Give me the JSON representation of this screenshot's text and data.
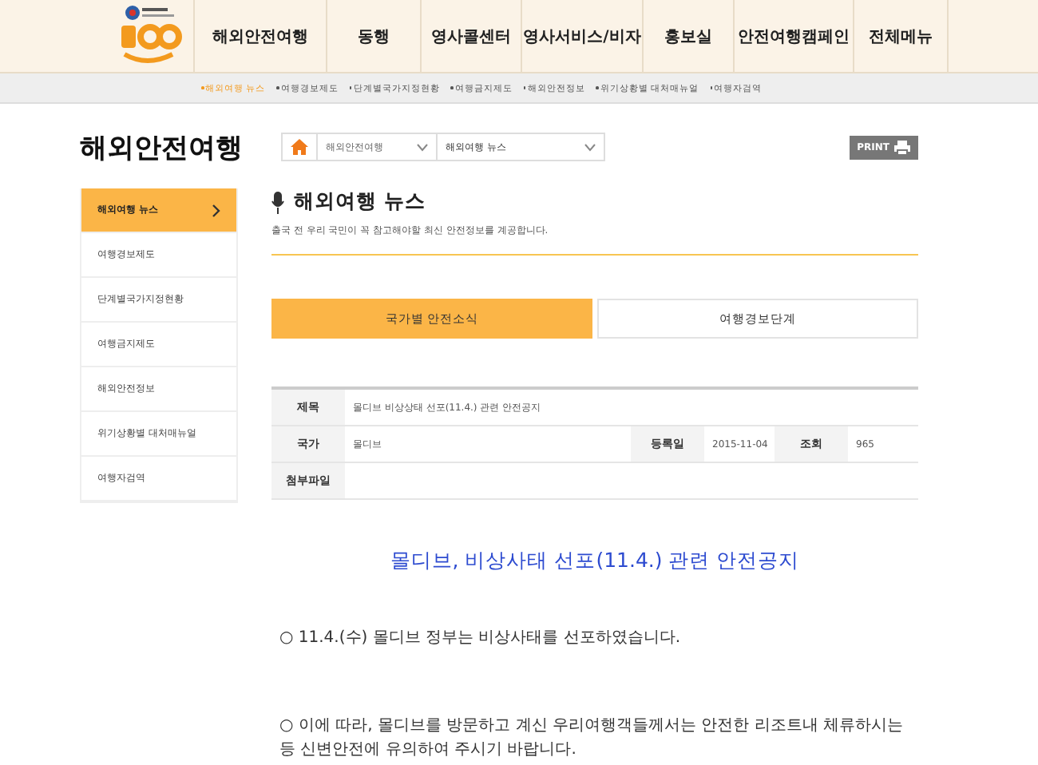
{
  "nav": [
    {
      "label": "해외안전여행",
      "selected": false
    },
    {
      "label": "동행",
      "selected": false
    },
    {
      "label": "영사콜센터",
      "selected": false
    },
    {
      "label": "영사서비스/비자",
      "selected": false
    },
    {
      "label": "홍보실",
      "selected": false
    },
    {
      "label": "안전여행캠페인",
      "selected": false
    },
    {
      "label": "전체메뉴",
      "selected": false
    }
  ],
  "subnav": [
    {
      "label": "해외여행 뉴스",
      "selected": true
    },
    {
      "label": "여행경보제도",
      "selected": false
    },
    {
      "label": "단계별국가지정현황",
      "selected": false
    },
    {
      "label": "여행금지제도",
      "selected": false
    },
    {
      "label": "해외안전정보",
      "selected": false
    },
    {
      "label": "위기상황별 대처매뉴얼",
      "selected": false
    },
    {
      "label": "여행자검역",
      "selected": false
    }
  ],
  "section_title": "해외안전여행",
  "breadcrumb": [
    "해외안전여행",
    "해외여행 뉴스"
  ],
  "print_button": "PRINT",
  "sidebar": [
    {
      "label": "해외여행 뉴스",
      "selected": true
    },
    {
      "label": "여행경보제도",
      "selected": false
    },
    {
      "label": "단계별국가지정현황",
      "selected": false
    },
    {
      "label": "여행금지제도",
      "selected": false
    },
    {
      "label": "해외안전정보",
      "selected": false
    },
    {
      "label": "위기상황별 대처매뉴얼",
      "selected": false
    },
    {
      "label": "여행자검역",
      "selected": false
    }
  ],
  "page_title": "해외여행 뉴스",
  "page_description": "출국 전 우리 국민이 꼭 참고해야할 최신 안전정보를 계공합니다.",
  "tabs": [
    {
      "label": "국가별 안전소식",
      "selected": true
    },
    {
      "label": "여행경보단계",
      "selected": false
    }
  ],
  "details": {
    "title_label": "제목",
    "title": "몰디브 비상상태 선포(11.4.) 관련 안전공지",
    "country_label": "국가",
    "country": "몰디브",
    "date_label": "등록일",
    "date": "2015-11-04",
    "views_label": "조회",
    "views": "965",
    "attachment_label": "첨부파일"
  },
  "article": {
    "heading": "몰디브, 비상사태 선포(11.4.) 관련 안전공지",
    "paragraphs": [
      "○ 11.4.(수) 몰디브 정부는 비상사태를 선포하였습니다.",
      "○ 이에 따라, 몰디브를 방문하고 계신 우리여행객들께서는 안전한 리조트내 체류하시는 등 신변안전에 유의하여 주시기 바랍니다."
    ]
  }
}
